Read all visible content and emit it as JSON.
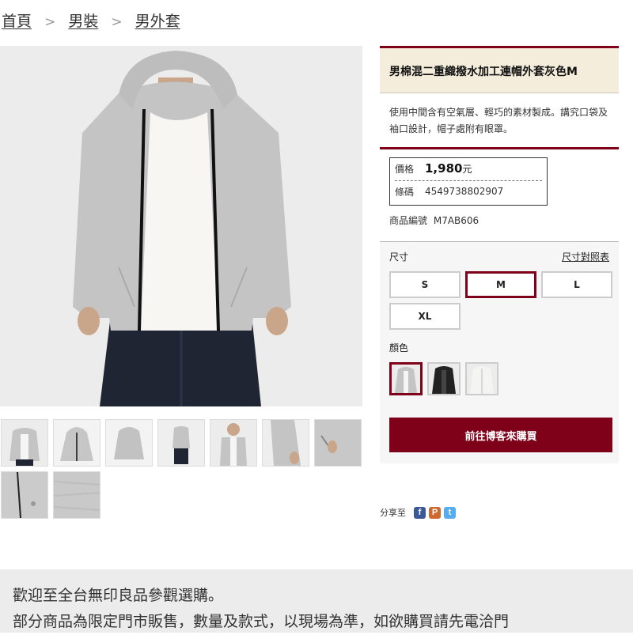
{
  "breadcrumb": {
    "home": "首頁",
    "sep1": ">",
    "men": "男裝",
    "sep2": ">",
    "outerwear": "男外套"
  },
  "product": {
    "title": "男棉混二重織撥水加工連帽外套灰色M",
    "description": "使用中間含有空氣層、輕巧的素材製成。講究口袋及袖口設計，帽子處附有眼罩。",
    "price_label": "價格",
    "price_value": "1,980",
    "price_unit": "元",
    "barcode_label": "條碼",
    "barcode_value": "4549738802907",
    "product_no_label": "商品編號",
    "product_no_value": "M7AB606"
  },
  "options": {
    "size_label": "尺寸",
    "size_chart_link": "尺寸對照表",
    "sizes": [
      "S",
      "M",
      "L",
      "XL"
    ],
    "selected_size": "M",
    "color_label": "顏色",
    "colors": [
      {
        "name": "gray-hoodie-swatch",
        "selected": true
      },
      {
        "name": "black-hoodie-swatch",
        "selected": false
      },
      {
        "name": "white-hoodie-swatch",
        "selected": false
      }
    ]
  },
  "buy_button": "前往博客來購買",
  "share": {
    "label": "分享至",
    "icons": [
      "facebook-icon",
      "plurk-icon",
      "twitter-icon"
    ]
  },
  "notice": {
    "line1": "歡迎至全台無印良品參觀選購。",
    "line2": "部分商品為限定門市販售，數量及款式，以現場為準，如欲購買請先電洽門"
  },
  "colors": {
    "accent": "#7f0019",
    "title_bg": "#f4eddc",
    "notice_bg": "#ececec"
  }
}
